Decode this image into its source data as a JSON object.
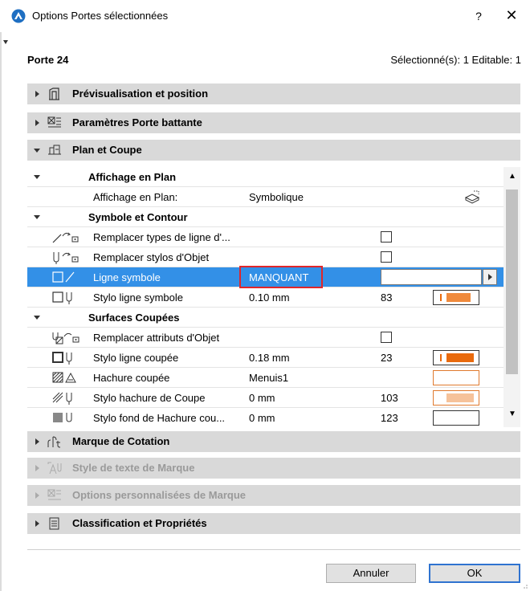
{
  "window": {
    "title": "Options Portes sélectionnées",
    "help_label": "?",
    "close_label": "✕"
  },
  "header": {
    "element_name": "Porte 24",
    "selection_info": "Sélectionné(s): 1 Editable: 1"
  },
  "sections": {
    "preview": {
      "label": "Prévisualisation et position",
      "icon": "preview-icon"
    },
    "door_params": {
      "label": "Paramètres Porte battante",
      "icon": "parameters-icon"
    },
    "plan_section": {
      "label": "Plan et Coupe",
      "icon": "plan-section-icon"
    },
    "dimension_marker": {
      "label": "Marque de Cotation",
      "icon": "dimension-marker-icon"
    },
    "marker_text_style": {
      "label": "Style de texte de Marque",
      "icon": "text-style-icon"
    },
    "marker_custom": {
      "label": "Options personnalisées de Marque",
      "icon": "custom-settings-icon"
    },
    "classification": {
      "label": "Classification et Propriétés",
      "icon": "document-icon"
    }
  },
  "tree": {
    "plan_display_group": "Affichage en Plan",
    "plan_display": {
      "name": "Affichage en Plan:",
      "value": "Symbolique"
    },
    "symbol_outline_group": "Symbole et Contour",
    "override_linetypes": {
      "name": "Remplacer types de ligne d'..."
    },
    "override_pens": {
      "name": "Remplacer stylos d'Objet"
    },
    "symbol_line": {
      "name": "Ligne symbole",
      "value": "MANQUANT"
    },
    "symbol_line_pen": {
      "name": "Stylo ligne symbole",
      "value": "0.10 mm",
      "pen": "83"
    },
    "cut_surfaces_group": "Surfaces Coupées",
    "override_attrs": {
      "name": "Remplacer attributs d'Objet"
    },
    "cut_line_pen": {
      "name": "Stylo ligne coupée",
      "value": "0.18 mm",
      "pen": "23"
    },
    "cut_fill": {
      "name": "Hachure coupée",
      "value": "Menuis1"
    },
    "cut_fill_pen": {
      "name": "Stylo hachure de Coupe",
      "value": "0 mm",
      "pen": "103"
    },
    "cut_fill_bg": {
      "name": "Stylo fond de Hachure cou...",
      "value": "0 mm",
      "pen": "123"
    }
  },
  "buttons": {
    "cancel": "Annuler",
    "ok": "OK"
  },
  "colors": {
    "selection": "#3390e7",
    "highlight_box": "#e0262a",
    "pen_orange": "#f08a3c"
  }
}
